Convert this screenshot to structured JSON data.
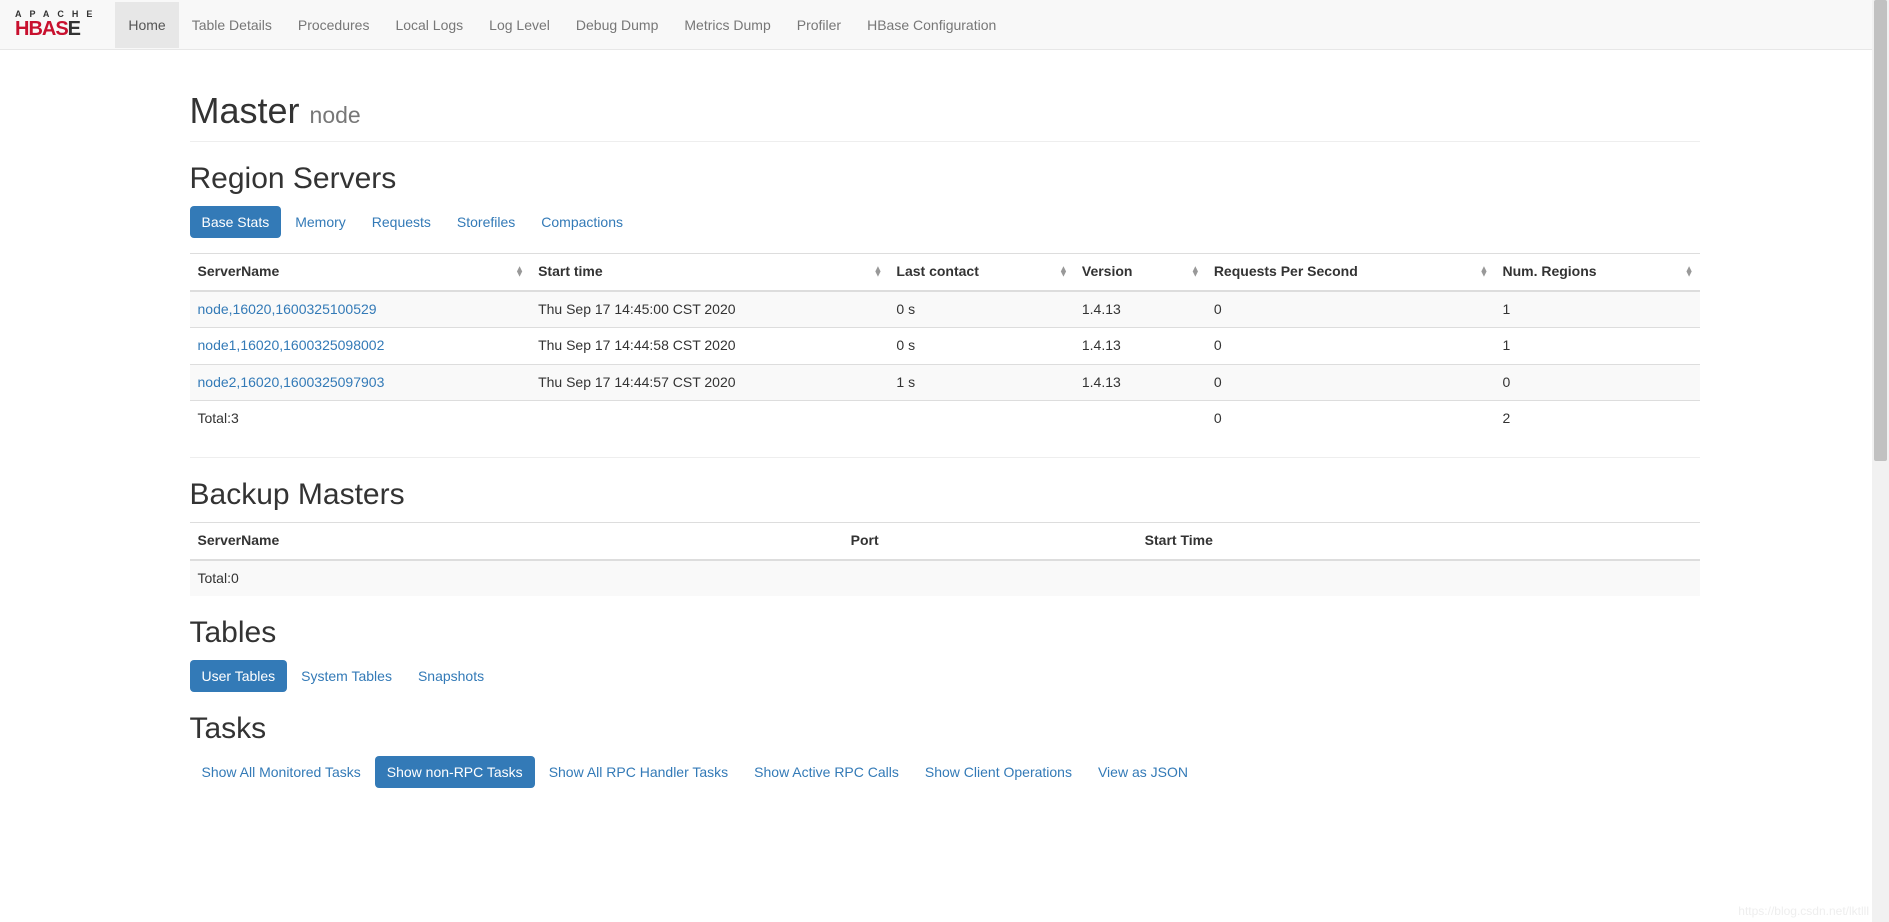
{
  "nav": {
    "items": [
      {
        "label": "Home",
        "active": true
      },
      {
        "label": "Table Details",
        "active": false
      },
      {
        "label": "Procedures",
        "active": false
      },
      {
        "label": "Local Logs",
        "active": false
      },
      {
        "label": "Log Level",
        "active": false
      },
      {
        "label": "Debug Dump",
        "active": false
      },
      {
        "label": "Metrics Dump",
        "active": false
      },
      {
        "label": "Profiler",
        "active": false
      },
      {
        "label": "HBase Configuration",
        "active": false
      }
    ]
  },
  "header": {
    "title": "Master",
    "subtitle": "node"
  },
  "region_servers": {
    "heading": "Region Servers",
    "tabs": [
      {
        "label": "Base Stats",
        "active": true
      },
      {
        "label": "Memory",
        "active": false
      },
      {
        "label": "Requests",
        "active": false
      },
      {
        "label": "Storefiles",
        "active": false
      },
      {
        "label": "Compactions",
        "active": false
      }
    ],
    "columns": [
      "ServerName",
      "Start time",
      "Last contact",
      "Version",
      "Requests Per Second",
      "Num. Regions"
    ],
    "rows": [
      {
        "server": "node,16020,1600325100529",
        "start": "Thu Sep 17 14:45:00 CST 2020",
        "contact": "0 s",
        "version": "1.4.13",
        "rps": "0",
        "regions": "1"
      },
      {
        "server": "node1,16020,1600325098002",
        "start": "Thu Sep 17 14:44:58 CST 2020",
        "contact": "0 s",
        "version": "1.4.13",
        "rps": "0",
        "regions": "1"
      },
      {
        "server": "node2,16020,1600325097903",
        "start": "Thu Sep 17 14:44:57 CST 2020",
        "contact": "1 s",
        "version": "1.4.13",
        "rps": "0",
        "regions": "0"
      }
    ],
    "total": {
      "label": "Total:3",
      "rps": "0",
      "regions": "2"
    }
  },
  "backup_masters": {
    "heading": "Backup Masters",
    "columns": [
      "ServerName",
      "Port",
      "Start Time"
    ],
    "total": "Total:0"
  },
  "tables": {
    "heading": "Tables",
    "tabs": [
      {
        "label": "User Tables",
        "active": true
      },
      {
        "label": "System Tables",
        "active": false
      },
      {
        "label": "Snapshots",
        "active": false
      }
    ]
  },
  "tasks": {
    "heading": "Tasks",
    "tabs": [
      {
        "label": "Show All Monitored Tasks",
        "active": false
      },
      {
        "label": "Show non-RPC Tasks",
        "active": true
      },
      {
        "label": "Show All RPC Handler Tasks",
        "active": false
      },
      {
        "label": "Show Active RPC Calls",
        "active": false
      },
      {
        "label": "Show Client Operations",
        "active": false
      },
      {
        "label": "View as JSON",
        "active": false
      }
    ]
  },
  "watermark": "https://blog.csdn.net/lktlll"
}
